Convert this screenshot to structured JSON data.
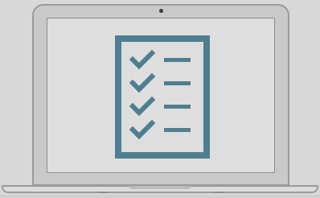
{
  "illustration": {
    "subject": "checklist",
    "items_checked": 4,
    "icons": {
      "laptop": "laptop-icon",
      "document": "checklist-icon",
      "check": "checkmark-icon"
    },
    "colors": {
      "accent": "#4e7f91",
      "background": "#d8d8d8",
      "bezel": "#c9c9c9",
      "screen": "#dedede",
      "outline": "#9a9a9a"
    }
  }
}
